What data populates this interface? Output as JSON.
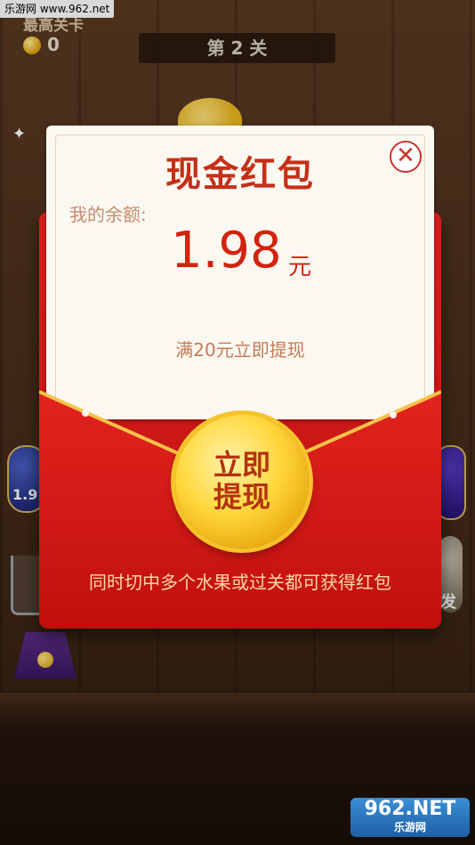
{
  "watermark_top": "乐游网 www.962.net",
  "header": {
    "score_label": "最高关卡",
    "coin_value": "0",
    "level": "第 2 关"
  },
  "side_panels": {
    "left_value": "1.9",
    "right_text": "发"
  },
  "red_packet": {
    "title": "现金红包",
    "balance_label": "我的余额:",
    "balance_value": "1.98",
    "balance_unit": "元",
    "threshold_text": "满20元立即提现",
    "withdraw_label_line1": "立即",
    "withdraw_label_line2": "提现",
    "footer_note": "同时切中多个水果或过关都可获得红包",
    "close_symbol": "✕"
  },
  "watermark_bottom": {
    "brand": "962.NET",
    "sub": "乐游网"
  },
  "colors": {
    "envelope_red": "#d21a16",
    "title_red": "#c52f18",
    "balance_red": "#d12410",
    "gold": "#ffd63a"
  }
}
